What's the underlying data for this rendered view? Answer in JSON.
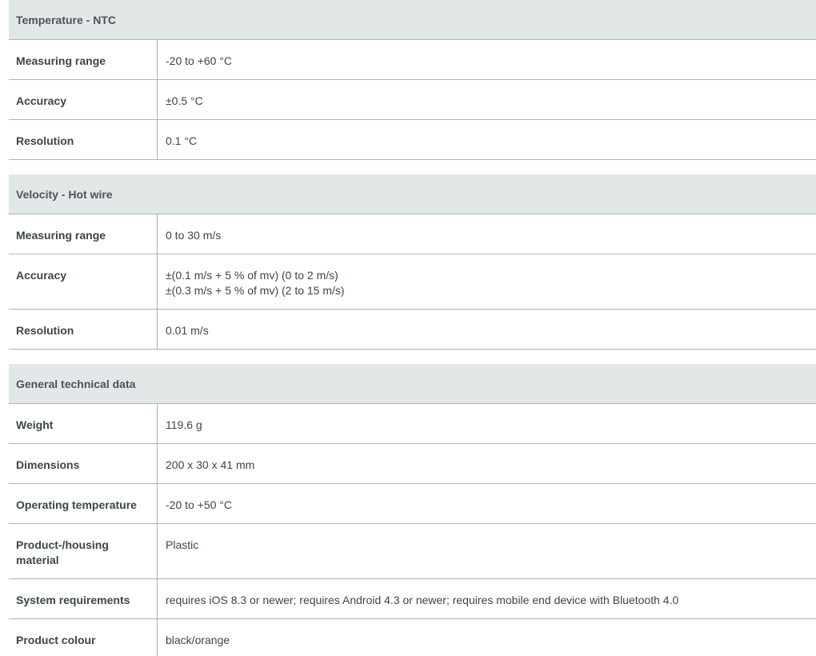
{
  "sections": [
    {
      "title": "Temperature - NTC",
      "rows": [
        {
          "label": "Measuring range",
          "values": [
            "-20 to +60 °C"
          ]
        },
        {
          "label": "Accuracy",
          "values": [
            "±0.5 °C"
          ]
        },
        {
          "label": "Resolution",
          "values": [
            "0.1 °C"
          ]
        }
      ]
    },
    {
      "title": "Velocity - Hot wire",
      "rows": [
        {
          "label": "Measuring range",
          "values": [
            "0 to 30 m/s"
          ]
        },
        {
          "label": "Accuracy",
          "values": [
            "±(0.1 m/s + 5 % of mv) (0 to 2 m/s)",
            "±(0.3 m/s + 5 % of mv) (2 to 15 m/s)"
          ]
        },
        {
          "label": "Resolution",
          "values": [
            "0.01 m/s"
          ]
        }
      ]
    },
    {
      "title": "General technical data",
      "rows": [
        {
          "label": "Weight",
          "values": [
            "119.6 g"
          ]
        },
        {
          "label": "Dimensions",
          "values": [
            "200 x 30 x 41 mm"
          ]
        },
        {
          "label": "Operating temperature",
          "values": [
            "-20 to +50 °C"
          ]
        },
        {
          "label": "Product-/housing material",
          "values": [
            "Plastic"
          ]
        },
        {
          "label": "System requirements",
          "values": [
            "requires iOS 8.3 or newer; requires Android 4.3 or newer; requires mobile end device with Bluetooth 4.0"
          ]
        },
        {
          "label": "Product colour",
          "values": [
            "black/orange"
          ]
        }
      ]
    }
  ]
}
